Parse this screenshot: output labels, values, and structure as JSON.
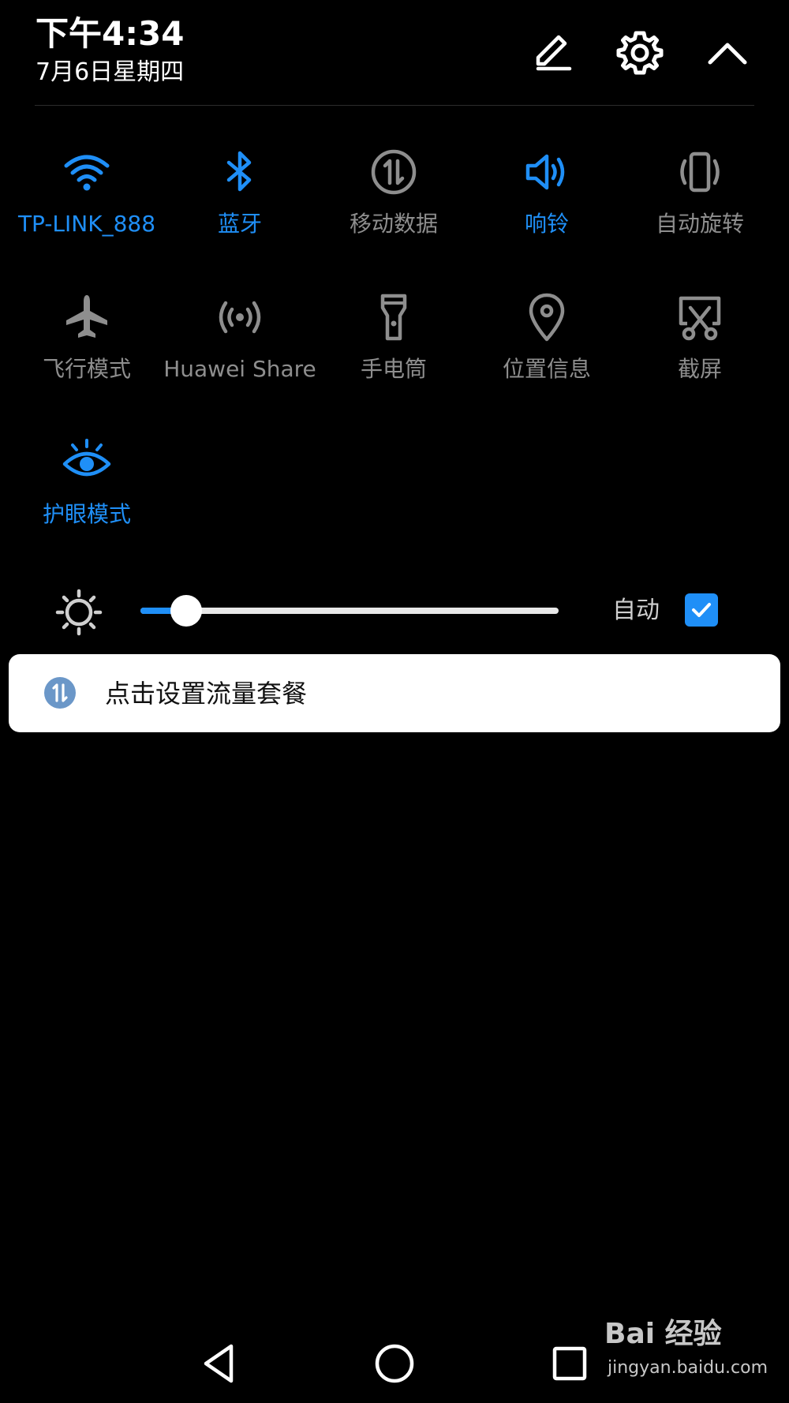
{
  "status": {
    "time": "下午4:34",
    "date": "7月6日星期四"
  },
  "header_actions": [
    {
      "name": "edit-icon"
    },
    {
      "name": "settings-icon"
    },
    {
      "name": "chevron-up-icon"
    }
  ],
  "tiles": [
    {
      "label": "TP-LINK_888",
      "icon": "wifi-icon",
      "active": true
    },
    {
      "label": "蓝牙",
      "icon": "bluetooth-icon",
      "active": true
    },
    {
      "label": "移动数据",
      "icon": "mobile-data-icon",
      "active": false
    },
    {
      "label": "响铃",
      "icon": "speaker-icon",
      "active": true
    },
    {
      "label": "自动旋转",
      "icon": "auto-rotate-icon",
      "active": false
    },
    {
      "label": "飞行模式",
      "icon": "airplane-icon",
      "active": false
    },
    {
      "label": "Huawei Share",
      "icon": "huawei-share-icon",
      "active": false
    },
    {
      "label": "手电筒",
      "icon": "flashlight-icon",
      "active": false
    },
    {
      "label": "位置信息",
      "icon": "location-icon",
      "active": false
    },
    {
      "label": "截屏",
      "icon": "screenshot-icon",
      "active": false
    },
    {
      "label": "护眼模式",
      "icon": "eye-comfort-icon",
      "active": true
    }
  ],
  "brightness": {
    "level": 0.11,
    "auto_label": "自动",
    "auto_checked": true
  },
  "notice": {
    "text": "点击设置流量套餐",
    "icon": "mobile-data-icon"
  },
  "nav": [
    {
      "name": "back-icon"
    },
    {
      "name": "home-icon"
    },
    {
      "name": "recents-icon"
    }
  ],
  "watermark": {
    "logo_text": "Bai 经验",
    "url": "jingyan.baidu.com"
  },
  "colors": {
    "accent": "#1f8ff7",
    "inactive": "#8e8e8e",
    "background": "#000000",
    "card": "#ffffff"
  }
}
